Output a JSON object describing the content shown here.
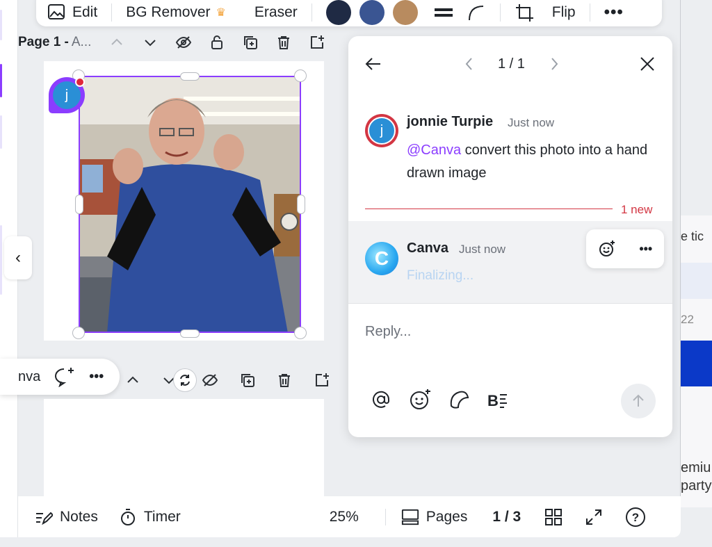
{
  "toolbar": {
    "edit_label": "Edit",
    "bg_remover_label": "BG Remover",
    "eraser_label": "Eraser",
    "flip_label": "Flip",
    "swatches": [
      "#1f2a44",
      "#3a5592",
      "#b88b5f"
    ]
  },
  "page1": {
    "title": "Page 1 -",
    "subtitle": "A..."
  },
  "avatar_initial": "j",
  "pill": {
    "label": "nva"
  },
  "bottombar": {
    "notes_label": "Notes",
    "timer_label": "Timer",
    "zoom": "25%",
    "pages_label": "Pages",
    "page_indicator": "1 / 3"
  },
  "panel": {
    "counter": "1 / 1",
    "comment": {
      "author": "jonnie Turpie",
      "time": "Just now",
      "mention": "@Canva",
      "text": " convert this photo into a hand drawn image"
    },
    "new_label": "1 new",
    "ai_reply": {
      "author": "Canva",
      "time": "Just now",
      "status": "Finalizing..."
    },
    "reply_placeholder": "Reply..."
  },
  "background_window": {
    "text1": "e tic",
    "text2": "22",
    "text3a": "emiu",
    "text3b": "party"
  },
  "colors": {
    "accent": "#8b3dff",
    "alert": "#d33643",
    "user_avatar": "#2a8fd6"
  }
}
